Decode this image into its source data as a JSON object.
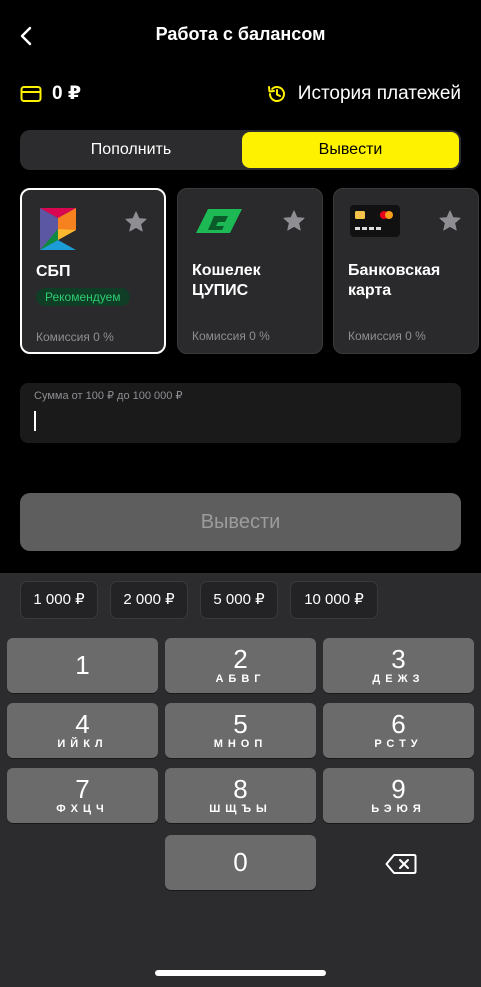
{
  "header": {
    "title": "Работа с балансом"
  },
  "balance": {
    "amount": "0 ₽",
    "history_label": "История платежей"
  },
  "tabs": [
    {
      "label": "Пополнить"
    },
    {
      "label": "Вывести"
    }
  ],
  "methods": [
    {
      "name": "СБП",
      "badge": "Рекомендуем",
      "fee": "Комиссия 0 %"
    },
    {
      "name": "Кошелек ЦУПИС",
      "fee": "Комиссия 0 %"
    },
    {
      "name": "Банковская карта",
      "fee": "Комиссия 0 %"
    }
  ],
  "amount_field": {
    "label": "Сумма от 100 ₽ до 100 000 ₽",
    "value": ""
  },
  "submit_label": "Вывести",
  "quick_amounts": [
    "1 000 ₽",
    "2 000 ₽",
    "5 000 ₽",
    "10 000 ₽"
  ],
  "keypad": [
    {
      "digit": "1",
      "letters": ""
    },
    {
      "digit": "2",
      "letters": "АБВГ"
    },
    {
      "digit": "3",
      "letters": "ДЕЖЗ"
    },
    {
      "digit": "4",
      "letters": "ИЙКЛ"
    },
    {
      "digit": "5",
      "letters": "МНОП"
    },
    {
      "digit": "6",
      "letters": "РСТУ"
    },
    {
      "digit": "7",
      "letters": "ФХЦЧ"
    },
    {
      "digit": "8",
      "letters": "ШЩЪЫ"
    },
    {
      "digit": "9",
      "letters": "ЬЭЮЯ"
    },
    {
      "digit": "0",
      "letters": ""
    }
  ],
  "colors": {
    "accent": "#fff200",
    "background": "#000000",
    "badge_text": "#2ecc71"
  }
}
